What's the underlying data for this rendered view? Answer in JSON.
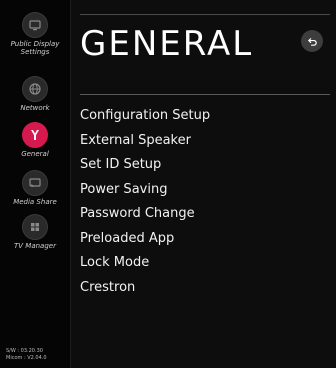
{
  "sidebar": {
    "items": [
      {
        "label": "Public Display\nSettings",
        "icon": "monitor-icon",
        "active": false
      },
      {
        "label": "Network",
        "icon": "globe-icon",
        "active": false
      },
      {
        "label": "General",
        "icon": "wrench-screwdriver-icon",
        "active": true
      },
      {
        "label": "Media Share",
        "icon": "cast-icon",
        "active": false
      },
      {
        "label": "TV Manager",
        "icon": "grid-icon",
        "active": false
      }
    ],
    "sw_version": "S/W : 03.20.30",
    "micom_version": "Micom : V2.04.0"
  },
  "header": {
    "title": "GENERAL"
  },
  "menu": {
    "items": [
      "Configuration Setup",
      "External Speaker",
      "Set ID Setup",
      "Power Saving",
      "Password Change",
      "Preloaded App",
      "Lock Mode",
      "Crestron"
    ]
  },
  "colors": {
    "accent": "#d6194f",
    "background": "#0d0d0d",
    "sidebar": "#050505"
  }
}
